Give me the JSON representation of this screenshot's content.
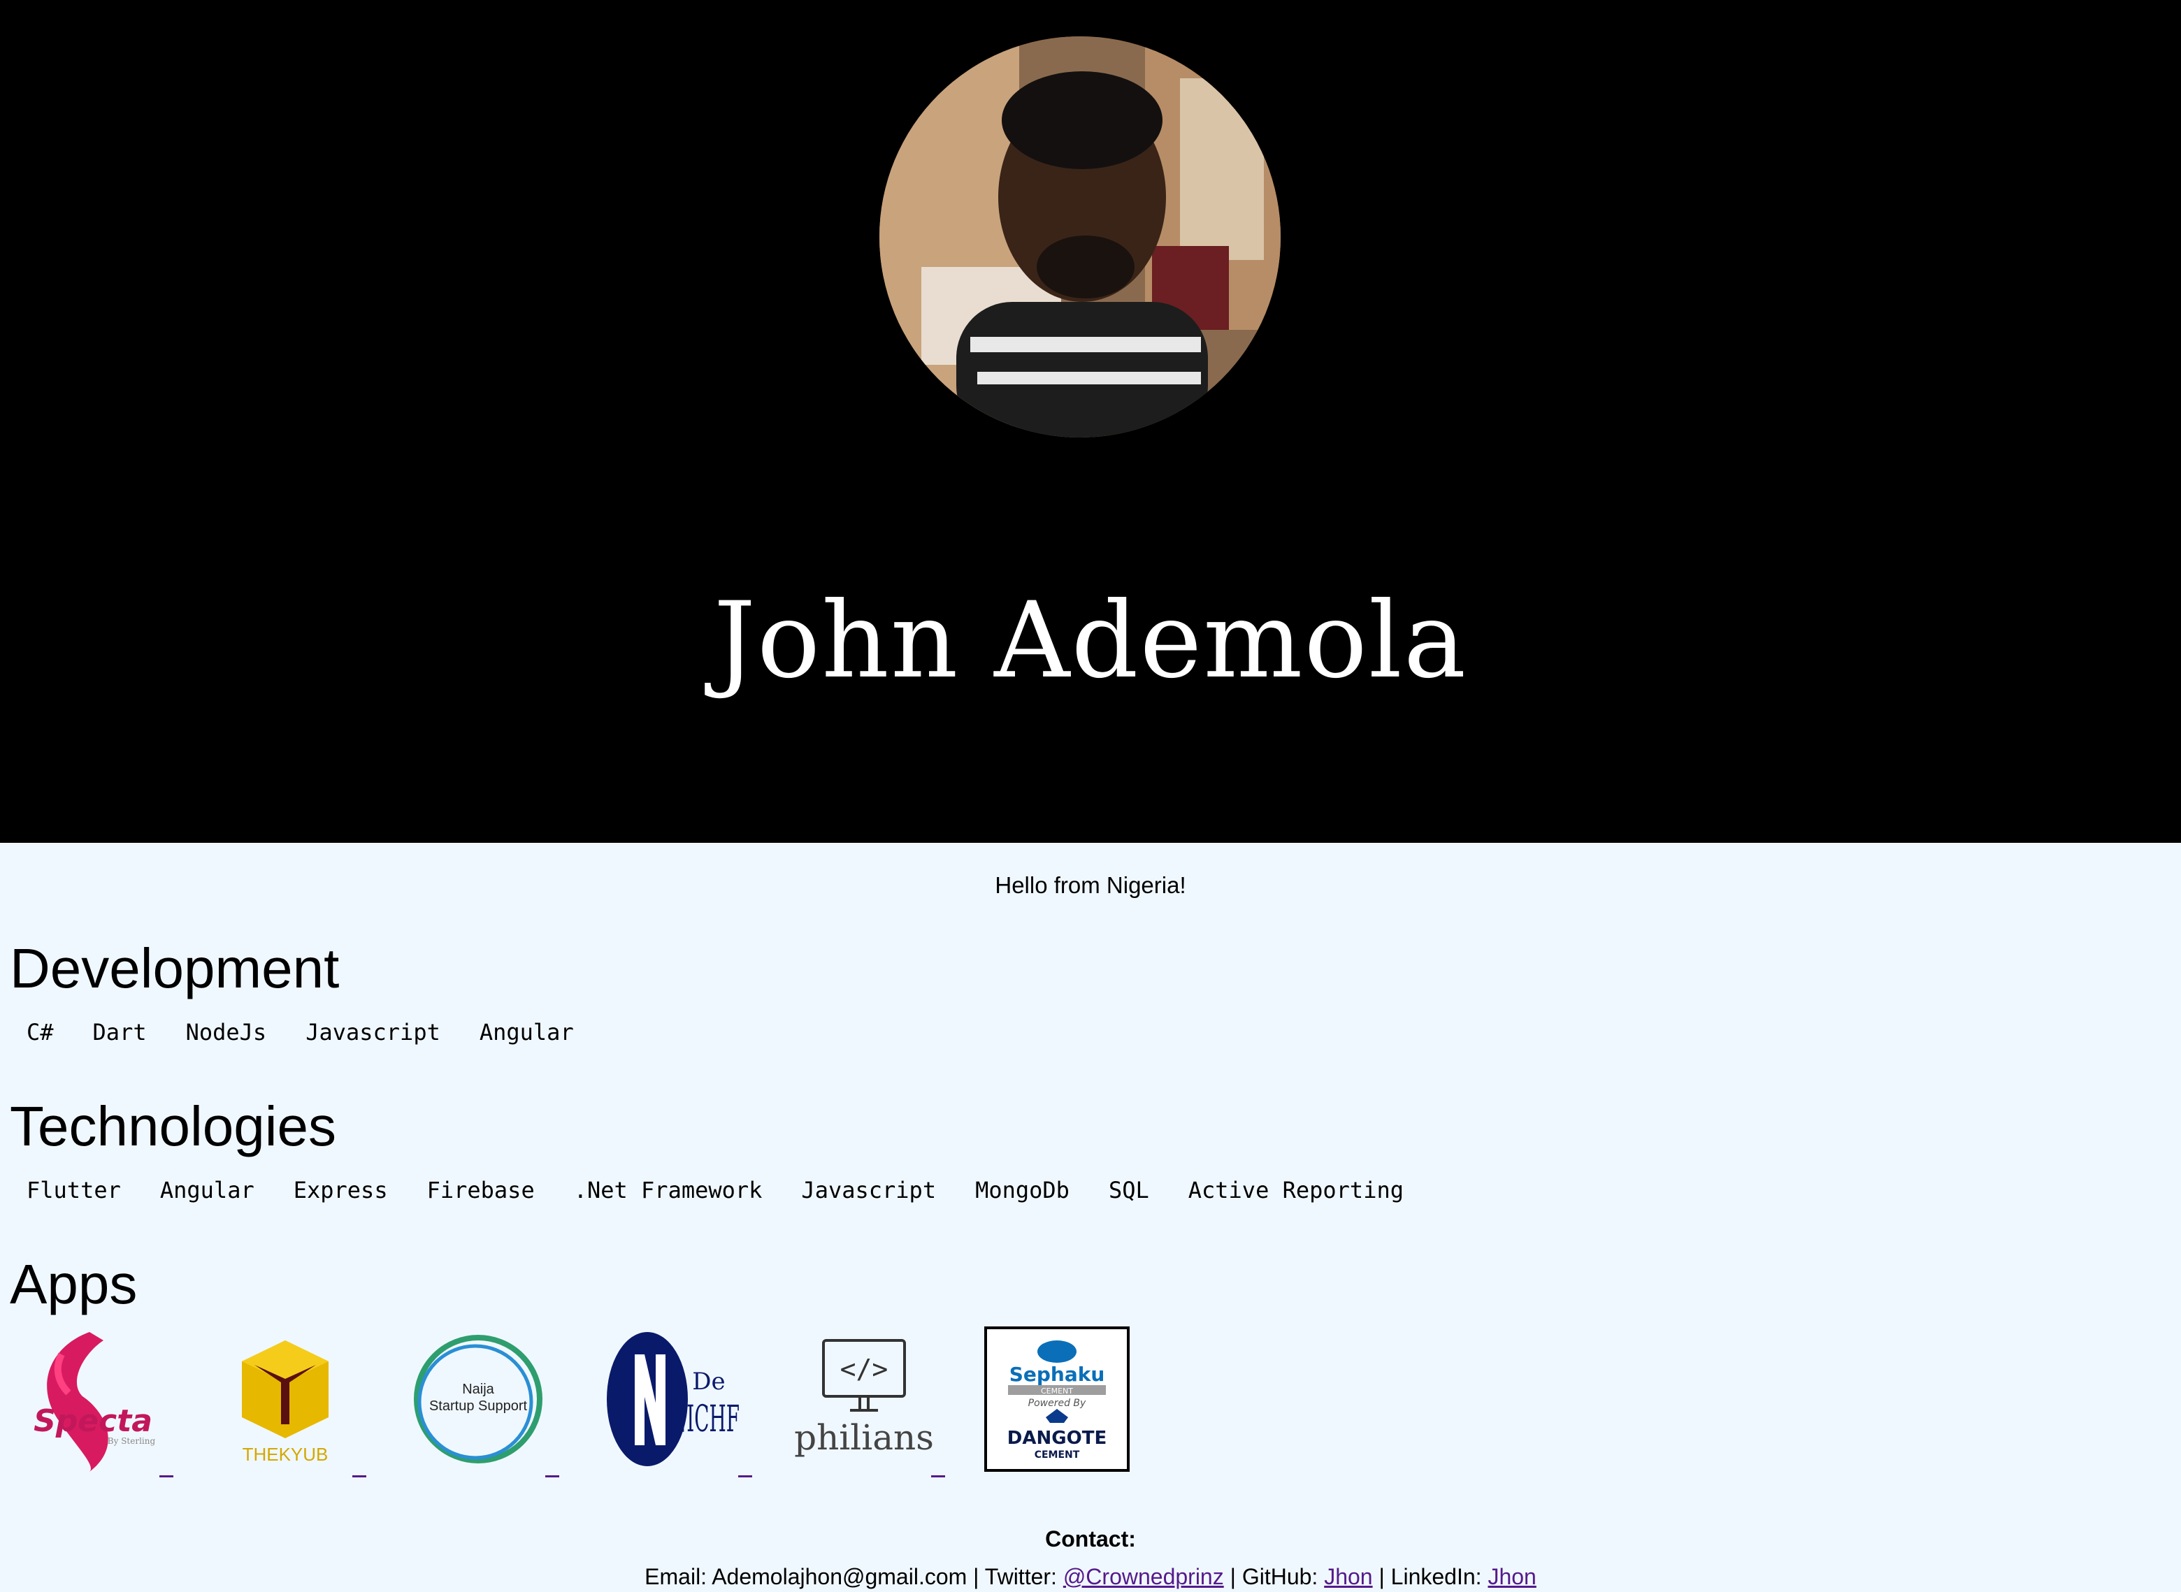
{
  "hero": {
    "name": "John Ademola"
  },
  "greeting": "Hello from Nigeria!",
  "development": {
    "title": "Development",
    "tags": [
      "C#",
      "Dart",
      "NodeJs",
      "Javascript",
      "Angular"
    ]
  },
  "technologies": {
    "title": "Technologies",
    "tags": [
      "Flutter",
      "Angular",
      "Express",
      "Firebase",
      ".Net Framework",
      "Javascript",
      "MongoDb",
      "SQL",
      "Active Reporting"
    ]
  },
  "apps": {
    "title": "Apps",
    "items": [
      {
        "label": "Specta",
        "sub": "By Sterling"
      },
      {
        "label": "THEKYUB"
      },
      {
        "label1": "Naija",
        "label2": "Startup Support"
      },
      {
        "label1": "De",
        "label2": "NICHF"
      },
      {
        "label": "philians",
        "glyph": "</>"
      },
      {
        "label1": "Sephaku",
        "label2": "CEMENT",
        "label3": "Powered By",
        "label4": "DANGOTE",
        "label5": "CEMENT"
      }
    ]
  },
  "contact": {
    "label": "Contact:",
    "email_prefix": "Email: Ademolajhon@gmail.com | Twitter: ",
    "twitter": "@Crownedprinz",
    "github_prefix": " | GitHub: ",
    "github": "Jhon",
    "linkedin_prefix": " | LinkedIn: ",
    "linkedin": "Jhon"
  },
  "colors": {
    "hero_bg": "#000000",
    "page_bg": "#f0f8ff",
    "link": "#551a8b",
    "specta": "#d81b60",
    "kyub": "#e6b800",
    "naija": "#2e9e6e",
    "nichf": "#0a1a6b",
    "sephaku": "#0a6fb8"
  }
}
